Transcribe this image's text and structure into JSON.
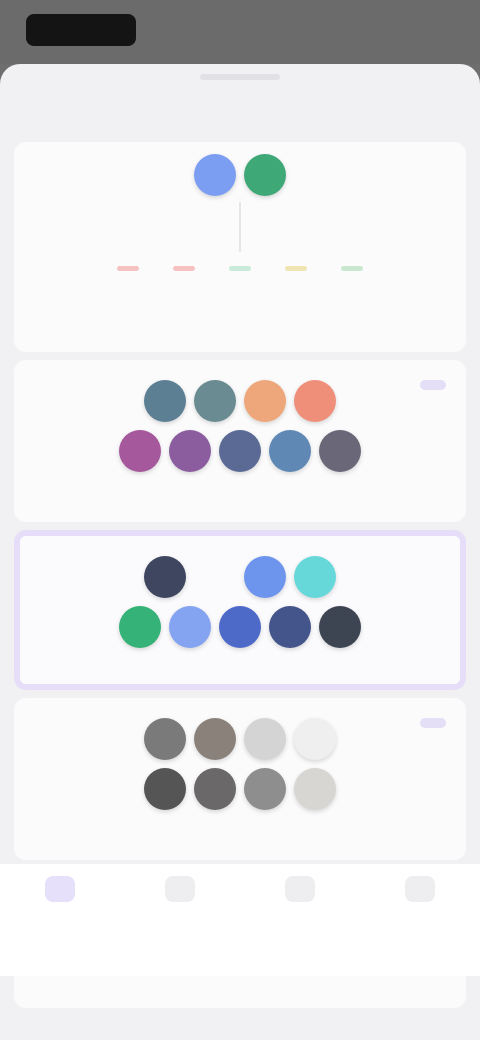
{
  "status_bar": {
    "time": ""
  },
  "hero": {
    "swatches": [
      "#7b9df2",
      "#3fa877"
    ],
    "caption": "",
    "dots": [
      "#f4c2bf",
      "#f6c2c0",
      "#c8ead9",
      "#f1e4b3",
      "#c9e7cf"
    ],
    "caption2": ""
  },
  "palettes": [
    {
      "title": "",
      "badge": "",
      "selected": false,
      "rows": [
        [
          "#5d7f93",
          "#6a8b92",
          "#eea77a",
          "#ef8f7a"
        ],
        [
          "#a5589c",
          "#8c5d9e",
          "#5b6a95",
          "#5f88b4",
          "#6a6878"
        ]
      ]
    },
    {
      "title": "",
      "badge": "",
      "selected": true,
      "rows": [
        [
          "#3f4660",
          "gap",
          "#6d95ee",
          "#67d8da"
        ],
        [
          "#35b277",
          "#84a4f2",
          "#4d6ac8",
          "#43558a",
          "#3e4552"
        ]
      ]
    },
    {
      "title": "",
      "badge": "",
      "selected": false,
      "rows": [
        [
          "#7a7a7a",
          "#8a817a",
          "#d4d4d4",
          "#efefef"
        ],
        [
          "#555555",
          "#6a6868",
          "#8e8e8e",
          "#d8d6d2"
        ]
      ]
    },
    {
      "title": "",
      "badge": "",
      "selected": false,
      "rows": [
        [
          "#b08a86",
          "#c0837d",
          "#cf8080",
          "#d87f82"
        ]
      ]
    }
  ],
  "tabbar": {
    "tabs": [
      {
        "label": "",
        "active": true
      },
      {
        "label": "",
        "active": false
      },
      {
        "label": "",
        "active": false
      },
      {
        "label": "",
        "active": false
      }
    ]
  }
}
